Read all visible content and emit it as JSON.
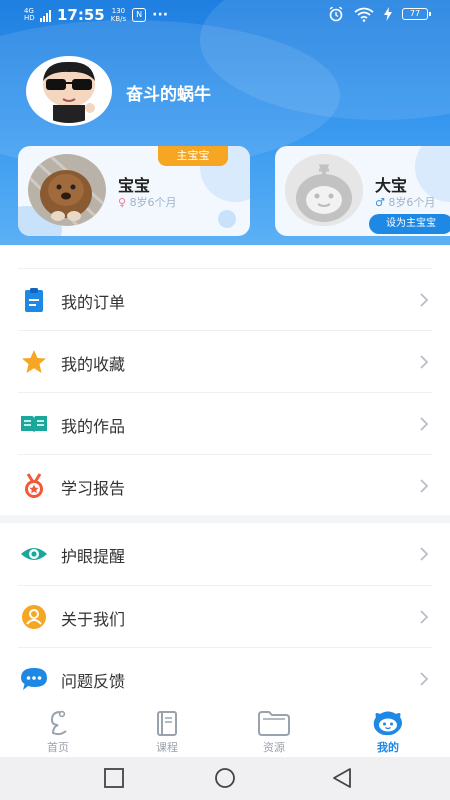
{
  "status_bar": {
    "network": "4G HD",
    "time": "17:55",
    "net_speed_value": "130",
    "net_speed_unit": "KB/s",
    "nfc": "N",
    "more": "···",
    "battery": "77"
  },
  "profile": {
    "username": "奋斗的蜗牛"
  },
  "children": [
    {
      "name": "宝宝",
      "age": "8岁6个月",
      "gender": "female",
      "gender_symbol": "♀",
      "tag": "主宝宝"
    },
    {
      "name": "大宝",
      "age": "8岁6个月",
      "gender": "male",
      "gender_symbol": "♂",
      "action": "设为主宝宝"
    }
  ],
  "menu": [
    {
      "label": "我的订单",
      "icon": "clipboard-icon",
      "color": "#1e88e5"
    },
    {
      "label": "我的收藏",
      "icon": "star-icon",
      "color": "#f5a623"
    },
    {
      "label": "我的作品",
      "icon": "open-book-icon",
      "color": "#1aa89c"
    },
    {
      "label": "学习报告",
      "icon": "medal-icon",
      "color": "#f05a3a"
    },
    {
      "label": "护眼提醒",
      "icon": "eye-icon",
      "color": "#1aa89c"
    },
    {
      "label": "关于我们",
      "icon": "person-icon",
      "color": "#f5a623"
    },
    {
      "label": "问题反馈",
      "icon": "chat-bubble-icon",
      "color": "#1e88e5"
    }
  ],
  "tabs": [
    {
      "label": "首页",
      "icon": "home-icon",
      "active": false
    },
    {
      "label": "课程",
      "icon": "book-icon",
      "active": false
    },
    {
      "label": "资源",
      "icon": "folder-icon",
      "active": false
    },
    {
      "label": "我的",
      "icon": "mine-face-icon",
      "active": true
    }
  ],
  "colors": {
    "header_blue": "#1e7fe0",
    "accent": "#1e88e5",
    "tag_orange": "#f6a623"
  }
}
